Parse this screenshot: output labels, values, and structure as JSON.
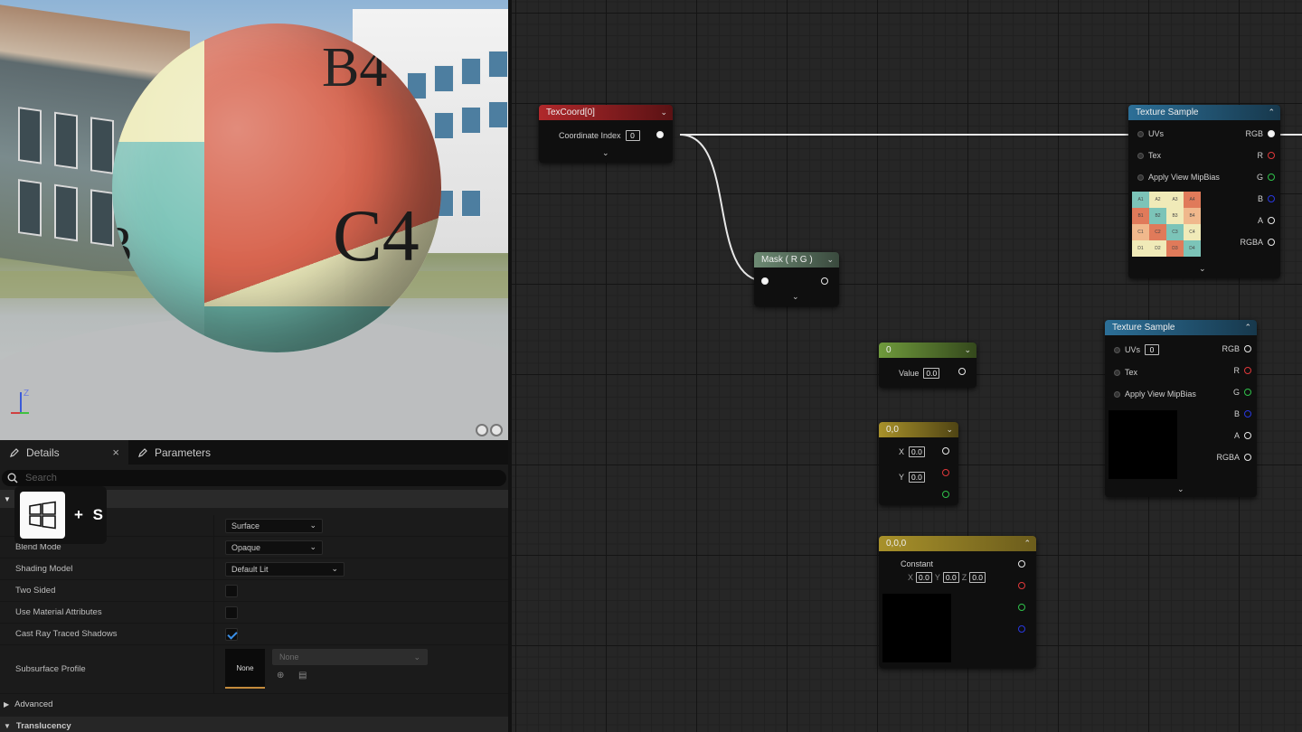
{
  "viewport": {
    "sphere_labels": [
      "B4",
      "C4",
      "3"
    ],
    "axis_label": "Z"
  },
  "details": {
    "tabs": [
      {
        "label": "Details",
        "close": "×"
      },
      {
        "label": "Parameters"
      }
    ],
    "search_placeholder": "Search",
    "rows": {
      "material_domain": {
        "value": "Surface"
      },
      "blend_mode": {
        "label": "Blend Mode",
        "value": "Opaque"
      },
      "shading_model": {
        "label": "Shading Model",
        "value": "Default Lit"
      },
      "two_sided": {
        "label": "Two Sided",
        "checked": false
      },
      "use_material_attributes": {
        "label": "Use Material Attributes",
        "checked": false
      },
      "cast_ray_traced_shadows": {
        "label": "Cast Ray Traced Shadows",
        "checked": true
      },
      "subsurface_profile": {
        "label": "Subsurface Profile",
        "thumb_text": "None",
        "dropdown": "None"
      }
    },
    "sections": {
      "advanced": "Advanced",
      "translucency": "Translucency"
    }
  },
  "hotkey_overlay": {
    "text": "+ S"
  },
  "graph": {
    "texcoord": {
      "title": "TexCoord[0]",
      "pin_label": "Coordinate Index",
      "pin_value": "0",
      "color": "#b0282b"
    },
    "mask": {
      "title": "Mask ( R G )",
      "color": "#6d8a73"
    },
    "constant1": {
      "title": "0",
      "pin_label": "Value",
      "pin_value": "0.0",
      "color": "#6f9a3c"
    },
    "constant2": {
      "title": "0,0",
      "x_label": "X",
      "x_value": "0.0",
      "y_label": "Y",
      "y_value": "0.0",
      "color": "#a8912a"
    },
    "constant3": {
      "title": "0,0,0",
      "label": "Constant",
      "x_label": "X",
      "x_value": "0.0",
      "y_label": "Y",
      "y_value": "0.0",
      "z_label": "Z",
      "z_value": "0.0",
      "color": "#a8912a"
    },
    "texture_sample_1": {
      "title": "Texture Sample",
      "inputs": [
        "UVs",
        "Tex",
        "Apply View MipBias"
      ],
      "outputs": [
        "RGB",
        "R",
        "G",
        "B",
        "A",
        "RGBA"
      ],
      "grid_labels": [
        "A1",
        "A2",
        "A3",
        "A4",
        "B1",
        "B2",
        "B3",
        "B4",
        "C1",
        "C2",
        "C3",
        "C4",
        "D1",
        "D2",
        "D3",
        "D4"
      ],
      "grid_colors": [
        "#7cc4b8",
        "#f0eab8",
        "#f0eab8",
        "#e07a5a",
        "#e07a5a",
        "#7cc4b8",
        "#f0eab8",
        "#f0b88c",
        "#f0b88c",
        "#e07a5a",
        "#7cc4b8",
        "#f0eab8",
        "#f0eab8",
        "#f0eab8",
        "#e07a5a",
        "#7cc4b8"
      ],
      "color": "#2c6f97"
    },
    "texture_sample_2": {
      "title": "Texture Sample",
      "inputs": [
        "UVs",
        "Tex",
        "Apply View MipBias"
      ],
      "uv_value": "0",
      "outputs": [
        "RGB",
        "R",
        "G",
        "B",
        "A",
        "RGBA"
      ],
      "color": "#2c6f97"
    }
  }
}
